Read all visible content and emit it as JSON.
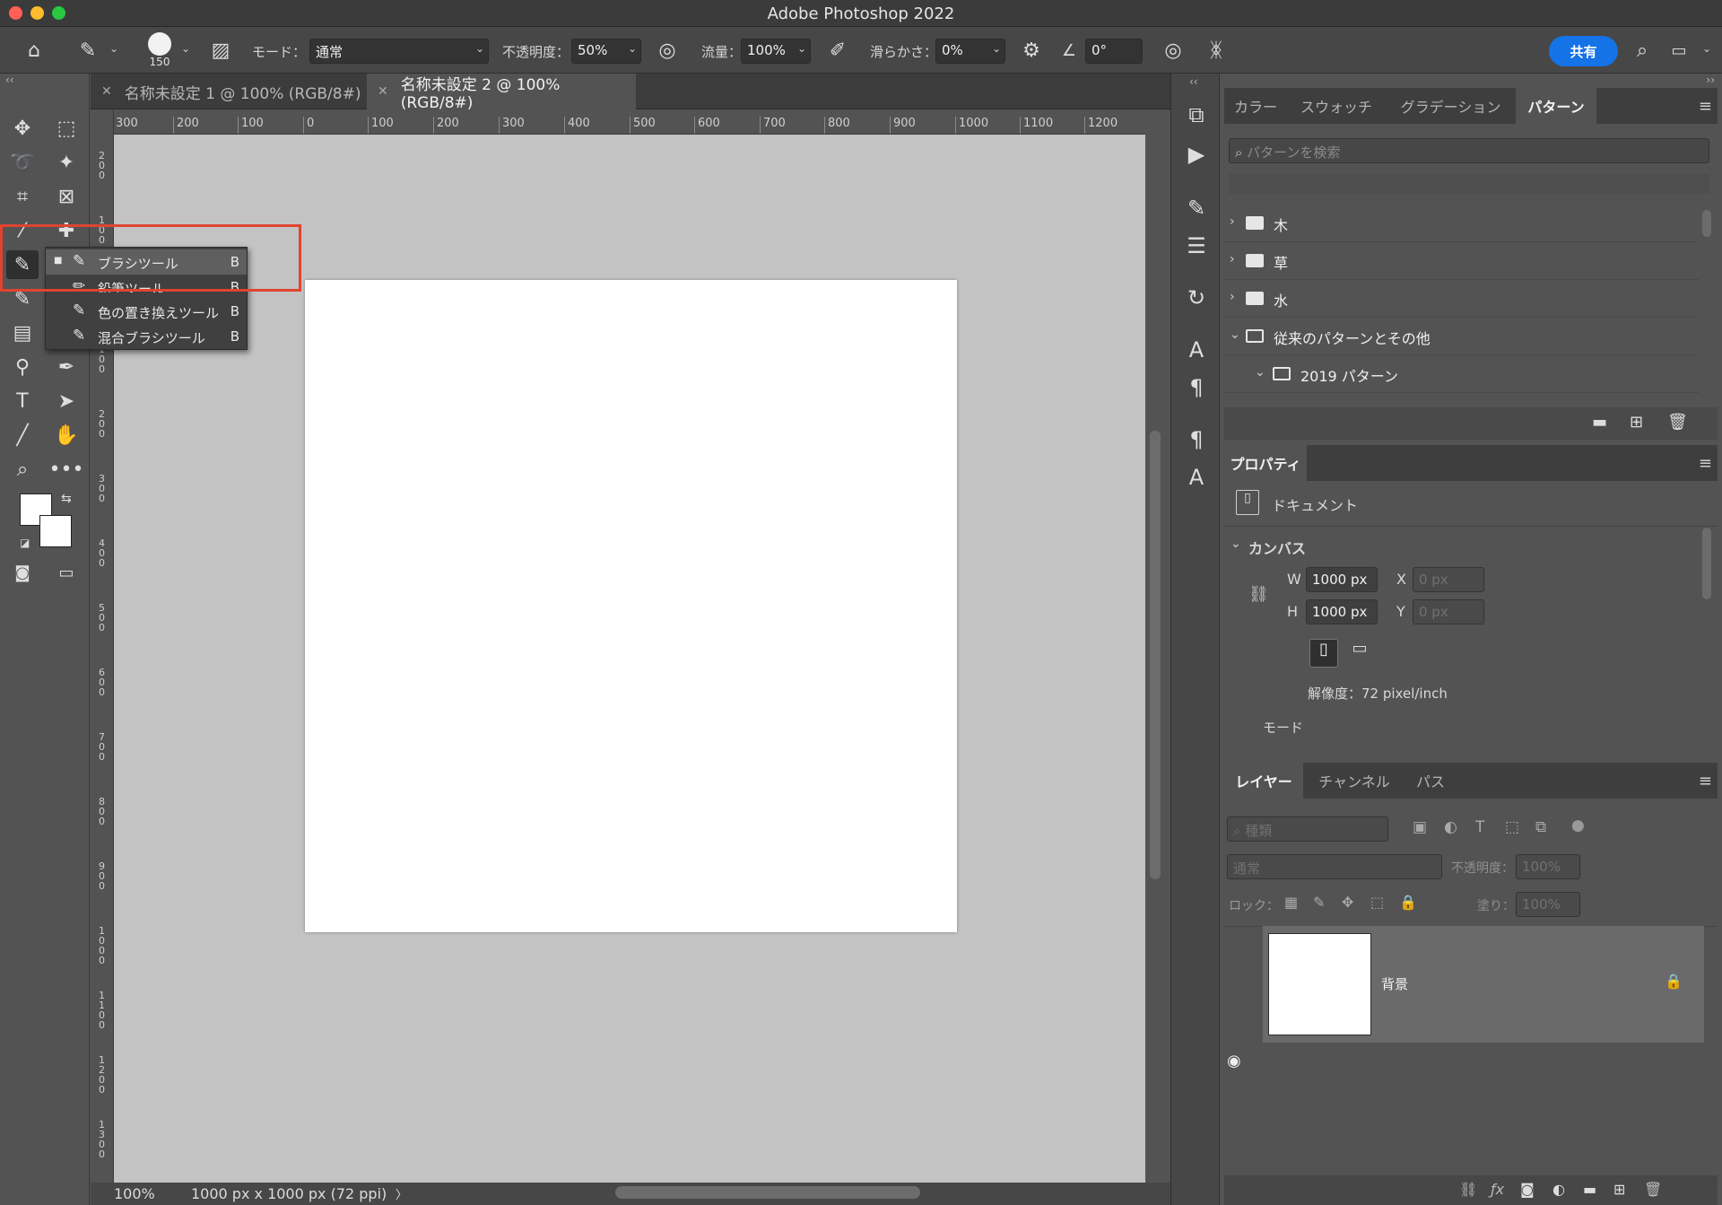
{
  "window": {
    "title": "Adobe Photoshop 2022"
  },
  "options_bar": {
    "brush_size": "150",
    "mode_label": "モード：",
    "mode_value": "通常",
    "opacity_label": "不透明度：",
    "opacity_value": "50%",
    "flow_label": "流量：",
    "flow_value": "100%",
    "smoothing_label": "滑らかさ：",
    "smoothing_value": "0%",
    "angle_value": "0°",
    "share_label": "共有"
  },
  "tabs": [
    {
      "label": "名称未設定 1 @ 100% (RGB/8#)"
    },
    {
      "label": "名称未設定 2 @ 100% (RGB/8#)"
    }
  ],
  "ruler_h": [
    "300",
    "200",
    "100",
    "0",
    "100",
    "200",
    "300",
    "400",
    "500",
    "600",
    "700",
    "800",
    "900",
    "1000",
    "1100",
    "1200"
  ],
  "ruler_v": [
    "200",
    "100",
    "0",
    "100",
    "200",
    "300",
    "400",
    "500",
    "600",
    "700",
    "800",
    "900",
    "1000",
    "1100",
    "1200",
    "1300"
  ],
  "tool_flyout": {
    "items": [
      {
        "label": "ブラシツール",
        "key": "B"
      },
      {
        "label": "鉛筆ツール",
        "key": "B"
      },
      {
        "label": "色の置き換えツール",
        "key": "B"
      },
      {
        "label": "混合ブラシツール",
        "key": "B"
      }
    ]
  },
  "status": {
    "zoom": "100%",
    "doc_info": "1000 px x 1000 px (72 ppi)",
    "arrow": "〉"
  },
  "patterns_panel": {
    "tabs": [
      "カラー",
      "スウォッチ",
      "グラデーション",
      "パターン"
    ],
    "search_placeholder": "パターンを検索",
    "folders": [
      {
        "name": "木"
      },
      {
        "name": "草"
      },
      {
        "name": "水"
      },
      {
        "name": "従来のパターンとその他"
      },
      {
        "name": "2019 パターン"
      }
    ]
  },
  "properties_panel": {
    "tab": "プロパティ",
    "doc_label": "ドキュメント",
    "canvas_label": "カンバス",
    "w_label": "W",
    "w_value": "1000 px",
    "h_label": "H",
    "h_value": "1000 px",
    "x_label": "X",
    "x_value": "0 px",
    "y_label": "Y",
    "y_value": "0 px",
    "resolution": "解像度：72 pixel/inch",
    "mode_label": "モード"
  },
  "layers_panel": {
    "tabs": [
      "レイヤー",
      "チャンネル",
      "パス"
    ],
    "filter_placeholder": "種類",
    "blend_mode": "通常",
    "opacity_label": "不透明度：",
    "opacity_value": "100%",
    "lock_label": "ロック：",
    "fill_label": "塗り：",
    "fill_value": "100%",
    "layers": [
      {
        "name": "背景"
      }
    ]
  }
}
